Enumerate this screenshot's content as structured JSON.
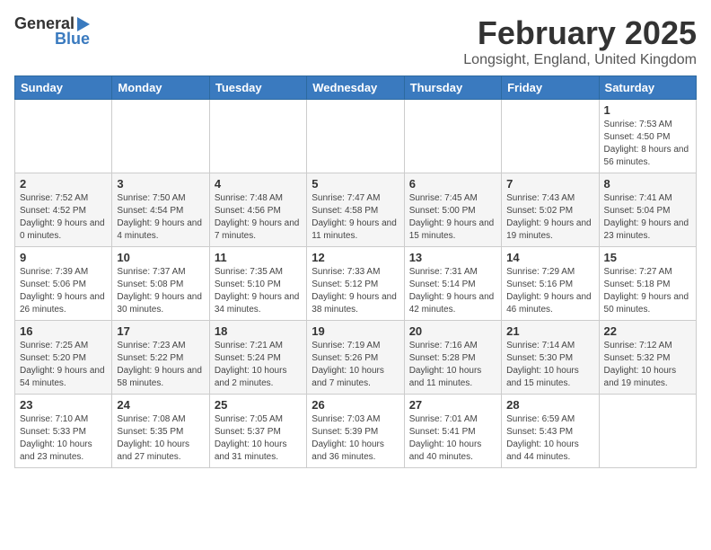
{
  "logo": {
    "general": "General",
    "blue": "Blue"
  },
  "title": "February 2025",
  "subtitle": "Longsight, England, United Kingdom",
  "days_of_week": [
    "Sunday",
    "Monday",
    "Tuesday",
    "Wednesday",
    "Thursday",
    "Friday",
    "Saturday"
  ],
  "weeks": [
    [
      {
        "day": "",
        "info": ""
      },
      {
        "day": "",
        "info": ""
      },
      {
        "day": "",
        "info": ""
      },
      {
        "day": "",
        "info": ""
      },
      {
        "day": "",
        "info": ""
      },
      {
        "day": "",
        "info": ""
      },
      {
        "day": "1",
        "info": "Sunrise: 7:53 AM\nSunset: 4:50 PM\nDaylight: 8 hours and 56 minutes."
      }
    ],
    [
      {
        "day": "2",
        "info": "Sunrise: 7:52 AM\nSunset: 4:52 PM\nDaylight: 9 hours and 0 minutes."
      },
      {
        "day": "3",
        "info": "Sunrise: 7:50 AM\nSunset: 4:54 PM\nDaylight: 9 hours and 4 minutes."
      },
      {
        "day": "4",
        "info": "Sunrise: 7:48 AM\nSunset: 4:56 PM\nDaylight: 9 hours and 7 minutes."
      },
      {
        "day": "5",
        "info": "Sunrise: 7:47 AM\nSunset: 4:58 PM\nDaylight: 9 hours and 11 minutes."
      },
      {
        "day": "6",
        "info": "Sunrise: 7:45 AM\nSunset: 5:00 PM\nDaylight: 9 hours and 15 minutes."
      },
      {
        "day": "7",
        "info": "Sunrise: 7:43 AM\nSunset: 5:02 PM\nDaylight: 9 hours and 19 minutes."
      },
      {
        "day": "8",
        "info": "Sunrise: 7:41 AM\nSunset: 5:04 PM\nDaylight: 9 hours and 23 minutes."
      }
    ],
    [
      {
        "day": "9",
        "info": "Sunrise: 7:39 AM\nSunset: 5:06 PM\nDaylight: 9 hours and 26 minutes."
      },
      {
        "day": "10",
        "info": "Sunrise: 7:37 AM\nSunset: 5:08 PM\nDaylight: 9 hours and 30 minutes."
      },
      {
        "day": "11",
        "info": "Sunrise: 7:35 AM\nSunset: 5:10 PM\nDaylight: 9 hours and 34 minutes."
      },
      {
        "day": "12",
        "info": "Sunrise: 7:33 AM\nSunset: 5:12 PM\nDaylight: 9 hours and 38 minutes."
      },
      {
        "day": "13",
        "info": "Sunrise: 7:31 AM\nSunset: 5:14 PM\nDaylight: 9 hours and 42 minutes."
      },
      {
        "day": "14",
        "info": "Sunrise: 7:29 AM\nSunset: 5:16 PM\nDaylight: 9 hours and 46 minutes."
      },
      {
        "day": "15",
        "info": "Sunrise: 7:27 AM\nSunset: 5:18 PM\nDaylight: 9 hours and 50 minutes."
      }
    ],
    [
      {
        "day": "16",
        "info": "Sunrise: 7:25 AM\nSunset: 5:20 PM\nDaylight: 9 hours and 54 minutes."
      },
      {
        "day": "17",
        "info": "Sunrise: 7:23 AM\nSunset: 5:22 PM\nDaylight: 9 hours and 58 minutes."
      },
      {
        "day": "18",
        "info": "Sunrise: 7:21 AM\nSunset: 5:24 PM\nDaylight: 10 hours and 2 minutes."
      },
      {
        "day": "19",
        "info": "Sunrise: 7:19 AM\nSunset: 5:26 PM\nDaylight: 10 hours and 7 minutes."
      },
      {
        "day": "20",
        "info": "Sunrise: 7:16 AM\nSunset: 5:28 PM\nDaylight: 10 hours and 11 minutes."
      },
      {
        "day": "21",
        "info": "Sunrise: 7:14 AM\nSunset: 5:30 PM\nDaylight: 10 hours and 15 minutes."
      },
      {
        "day": "22",
        "info": "Sunrise: 7:12 AM\nSunset: 5:32 PM\nDaylight: 10 hours and 19 minutes."
      }
    ],
    [
      {
        "day": "23",
        "info": "Sunrise: 7:10 AM\nSunset: 5:33 PM\nDaylight: 10 hours and 23 minutes."
      },
      {
        "day": "24",
        "info": "Sunrise: 7:08 AM\nSunset: 5:35 PM\nDaylight: 10 hours and 27 minutes."
      },
      {
        "day": "25",
        "info": "Sunrise: 7:05 AM\nSunset: 5:37 PM\nDaylight: 10 hours and 31 minutes."
      },
      {
        "day": "26",
        "info": "Sunrise: 7:03 AM\nSunset: 5:39 PM\nDaylight: 10 hours and 36 minutes."
      },
      {
        "day": "27",
        "info": "Sunrise: 7:01 AM\nSunset: 5:41 PM\nDaylight: 10 hours and 40 minutes."
      },
      {
        "day": "28",
        "info": "Sunrise: 6:59 AM\nSunset: 5:43 PM\nDaylight: 10 hours and 44 minutes."
      },
      {
        "day": "",
        "info": ""
      }
    ]
  ]
}
